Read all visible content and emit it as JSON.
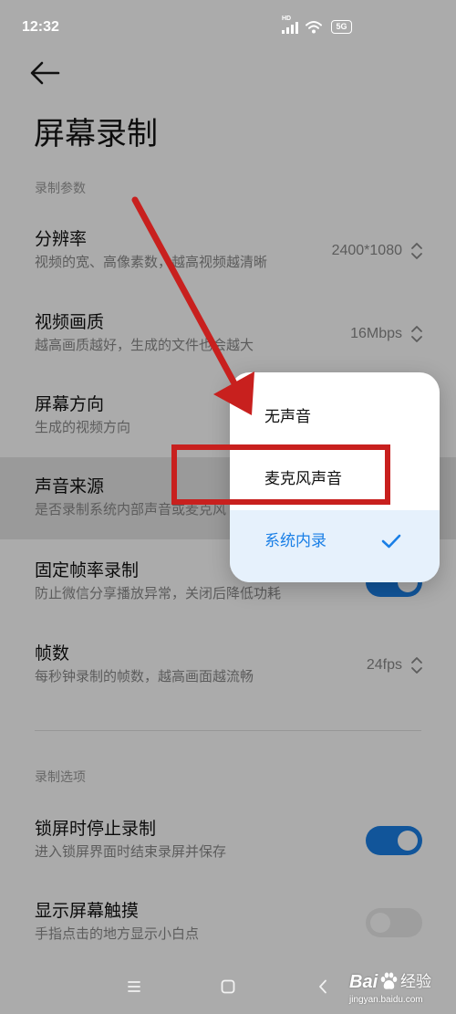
{
  "status_bar": {
    "time": "12:32",
    "network_label": "HD",
    "battery_label": "5G",
    "icons": [
      "signal-icon",
      "wifi-icon",
      "battery-icon"
    ]
  },
  "header": {
    "back_icon": "back-arrow-icon",
    "title": "屏幕录制"
  },
  "recording_params": {
    "label": "录制参数",
    "rows": [
      {
        "title": "分辨率",
        "subtitle": "视频的宽、高像素数，越高视频越清晰",
        "value": "2400*1080",
        "icon": "up-down-chevron-icon"
      },
      {
        "title": "视频画质",
        "subtitle": "越高画质越好，生成的文件也会越大",
        "value": "16Mbps",
        "icon": "up-down-chevron-icon"
      },
      {
        "title": "屏幕方向",
        "subtitle": "生成的视频方向"
      },
      {
        "title": "声音来源",
        "subtitle": "是否录制系统内部声音或麦克风"
      },
      {
        "title": "固定帧率录制",
        "subtitle": "防止微信分享播放异常，关闭后降低功耗",
        "toggle_on": true
      },
      {
        "title": "帧数",
        "subtitle": "每秒钟录制的帧数，越高画面越流畅",
        "value": "24fps",
        "icon": "up-down-chevron-icon"
      }
    ]
  },
  "recording_options": {
    "label": "录制选项",
    "rows": [
      {
        "title": "锁屏时停止录制",
        "subtitle": "进入锁屏界面时结束录屏并保存",
        "toggle_on": true
      },
      {
        "title": "显示屏幕触摸",
        "subtitle": "手指点击的地方显示小白点",
        "toggle_on": false
      }
    ]
  },
  "sound_source_menu": {
    "options": [
      {
        "label": "无声音",
        "selected": false
      },
      {
        "label": "麦克风声音",
        "selected": false
      },
      {
        "label": "系统内录",
        "selected": true
      }
    ],
    "selected_icon": "checkmark-icon"
  },
  "nav_bar": {
    "icons": [
      "menu-icon",
      "home-icon",
      "back-icon"
    ]
  },
  "watermark": {
    "logo_text": "Bai",
    "logo_icon": "paw-icon",
    "logo_suffix": "经验",
    "url": "jingyan.baidu.com"
  },
  "colors": {
    "accent": "#1a7fe6",
    "selected_option_bg": "#e6f1fc",
    "annotation": "#c8201e",
    "dim_overlay": "rgba(0,0,0,0.33)"
  }
}
